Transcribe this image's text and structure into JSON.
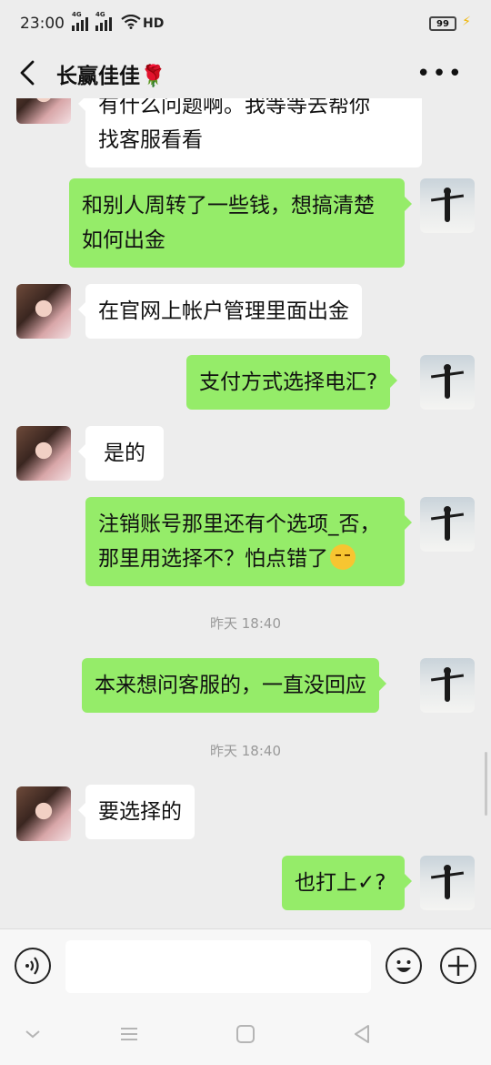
{
  "status_bar": {
    "time": "23:00",
    "signal1_label": "4G",
    "signal2_label": "4G",
    "network": "HD",
    "battery": "99"
  },
  "header": {
    "title": "长赢佳佳🌹",
    "back_icon": "back-chevron-icon",
    "more_icon": "more-dots-icon",
    "more_label": "•••"
  },
  "messages": [
    {
      "side": "left",
      "lines": [
        "有什么问题啊。我等等去帮你",
        "找客服看看"
      ]
    },
    {
      "side": "right",
      "lines": [
        "和别人周转了一些钱，想搞清楚",
        "如何出金"
      ]
    },
    {
      "side": "left",
      "lines": [
        "在官网上帐户管理里面出金"
      ]
    },
    {
      "side": "right",
      "lines": [
        "支付方式选择电汇?"
      ]
    },
    {
      "side": "left",
      "lines": [
        "是的"
      ]
    },
    {
      "side": "right",
      "lines": [
        "注销账号那里还有个选项_否，",
        "那里用选择不？怕点错了"
      ],
      "trailing_emoji": "pensive-face"
    },
    {
      "type": "time",
      "text": "昨天 18:40"
    },
    {
      "side": "right",
      "lines": [
        "本来想问客服的，一直没回应"
      ]
    },
    {
      "type": "time",
      "text": "昨天 18:40"
    },
    {
      "side": "left",
      "lines": [
        "要选择的"
      ]
    },
    {
      "side": "right",
      "lines": [
        "也打上✓?"
      ]
    }
  ],
  "input_bar": {
    "placeholder": "",
    "voice_icon": "voice-icon",
    "emoji_icon": "emoji-icon",
    "plus_icon": "plus-icon"
  },
  "nav_bar": {
    "items": [
      "chevron-down-icon",
      "menu-icon",
      "home-square-icon",
      "back-triangle-icon"
    ]
  },
  "colors": {
    "background": "#ededed",
    "bubble_self": "#95ec69",
    "bubble_other": "#ffffff",
    "timestamp": "#999999"
  }
}
